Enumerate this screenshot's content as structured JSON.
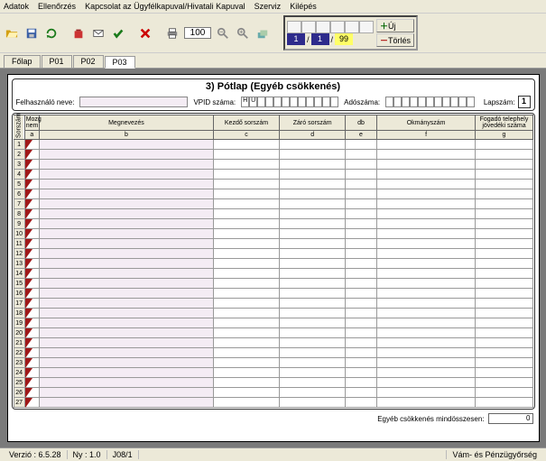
{
  "menu": {
    "items": [
      "Adatok",
      "Ellenőrzés",
      "Kapcsolat az Ügyfélkapuval/Hivatali Kapuval",
      "Szerviz",
      "Kilépés"
    ]
  },
  "toolbar": {
    "zoom": "100",
    "nav_add_label": "Új",
    "nav_del_label": "Törlés",
    "page_current": "1",
    "page_sep": "/",
    "page_of": "1",
    "page_total": "99"
  },
  "tabs": [
    "Főlap",
    "P01",
    "P02",
    "P03"
  ],
  "form": {
    "title": "3) Pótlap (Egyéb csökkenés)",
    "felhasznalo_label": "Felhasználó neve:",
    "vpid_label": "VPID száma:",
    "vpid_prefix": "HU",
    "adoszam_label": "Adószáma:",
    "lapszam_label": "Lapszám:",
    "lapszam_value": "1"
  },
  "grid": {
    "headers": {
      "sorszam": "Sorszám",
      "mozg": "Mozg nem",
      "megnevezes": "Megnevezés",
      "kezdo": "Kezdő sorszám",
      "zaro": "Záró sorszám",
      "db": "db",
      "okmanyszam": "Okmányszám",
      "fogado": "Fogadó telephely jövedéki száma"
    },
    "sub": {
      "a": "a",
      "b": "b",
      "c": "c",
      "d": "d",
      "e": "e",
      "f": "f",
      "g": "g"
    },
    "rowcount": 27
  },
  "totals": {
    "label": "Egyéb csökkenés mindösszesen:",
    "value": "0"
  },
  "status": {
    "verzio": "Verzió : 6.5.28",
    "ny": "Ny : 1.0",
    "doc": "J08/1",
    "org": "Vám- és Pénzügyőrség"
  }
}
